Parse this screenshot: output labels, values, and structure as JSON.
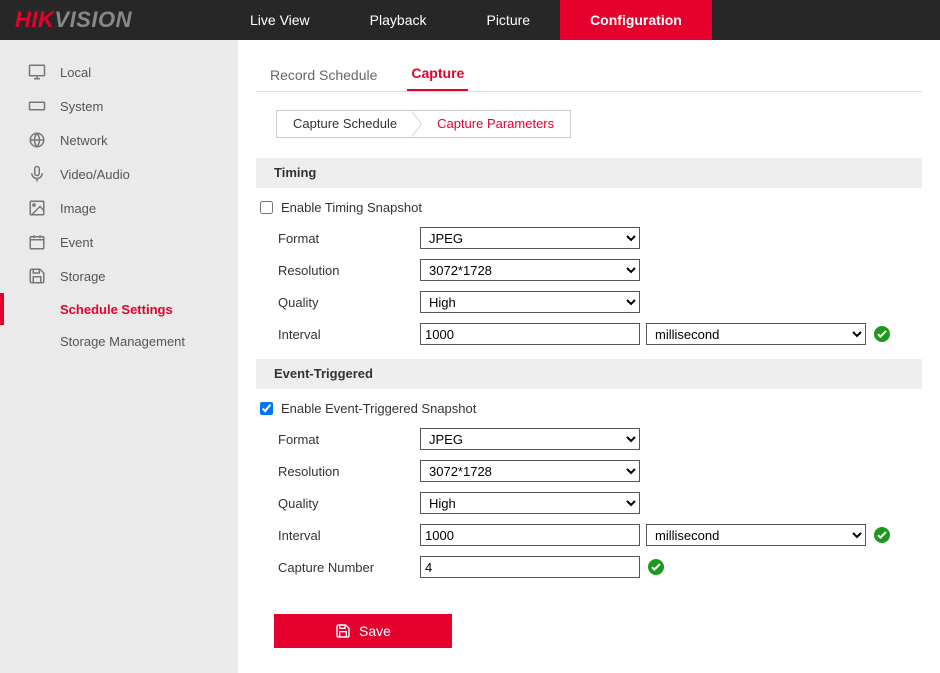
{
  "logo": {
    "hik": "HIK",
    "vision": "VISION"
  },
  "topnav": {
    "live_view": "Live View",
    "playback": "Playback",
    "picture": "Picture",
    "configuration": "Configuration"
  },
  "sidebar": {
    "local": "Local",
    "system": "System",
    "network": "Network",
    "video_audio": "Video/Audio",
    "image": "Image",
    "event": "Event",
    "storage": "Storage",
    "schedule_settings": "Schedule Settings",
    "storage_management": "Storage Management"
  },
  "ptabs": {
    "record_schedule": "Record Schedule",
    "capture": "Capture"
  },
  "subtabs": {
    "capture_schedule": "Capture Schedule",
    "capture_parameters": "Capture Parameters"
  },
  "timing": {
    "header": "Timing",
    "enable_label": "Enable Timing Snapshot",
    "enable_checked": false,
    "format_label": "Format",
    "format_value": "JPEG",
    "resolution_label": "Resolution",
    "resolution_value": "3072*1728",
    "quality_label": "Quality",
    "quality_value": "High",
    "interval_label": "Interval",
    "interval_value": "1000",
    "interval_unit": "millisecond"
  },
  "event": {
    "header": "Event-Triggered",
    "enable_label": "Enable Event-Triggered Snapshot",
    "enable_checked": true,
    "format_label": "Format",
    "format_value": "JPEG",
    "resolution_label": "Resolution",
    "resolution_value": "3072*1728",
    "quality_label": "Quality",
    "quality_value": "High",
    "interval_label": "Interval",
    "interval_value": "1000",
    "interval_unit": "millisecond",
    "capnum_label": "Capture Number",
    "capnum_value": "4"
  },
  "save_label": "Save"
}
